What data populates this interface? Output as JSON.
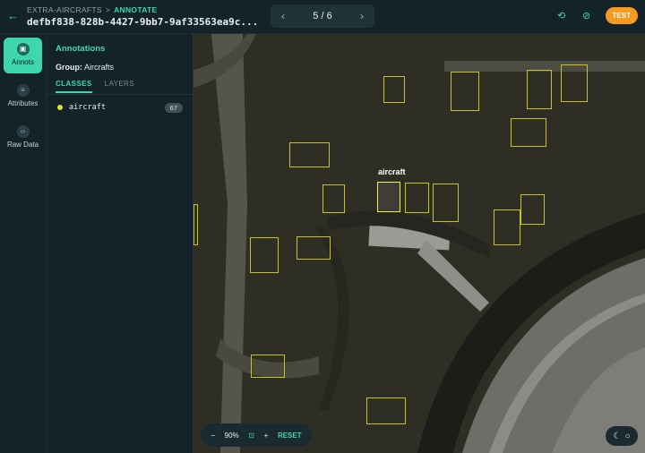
{
  "header": {
    "back_icon": "arrow-left-icon",
    "project": "EXTRA-AIRCRAFTS",
    "separator": ">",
    "mode": "ANNOTATE",
    "doc_id": "defbf838-828b-4427-9bb7-9af33563ea9c...",
    "pager": {
      "current": "5 / 6"
    },
    "test_label": "TEST"
  },
  "rail": {
    "items": [
      {
        "label": "Annots",
        "icon": "annotation-icon"
      },
      {
        "label": "Attributes",
        "icon": "list-icon"
      },
      {
        "label": "Raw Data",
        "icon": "code-icon"
      }
    ]
  },
  "panel": {
    "title": "Annotations",
    "group_label": "Group:",
    "group_value": "Aircrafts",
    "tabs": [
      "CLASSES",
      "LAYERS"
    ],
    "classes": [
      {
        "name": "aircraft",
        "count": "67",
        "color": "#d6e82a"
      }
    ]
  },
  "canvas": {
    "selected_label": "aircraft",
    "box_color": "#c9c222",
    "selected_color": "#f4f03a"
  },
  "zoom": {
    "minus": "−",
    "value": "90%",
    "plus": "+",
    "reset": "RESET"
  }
}
